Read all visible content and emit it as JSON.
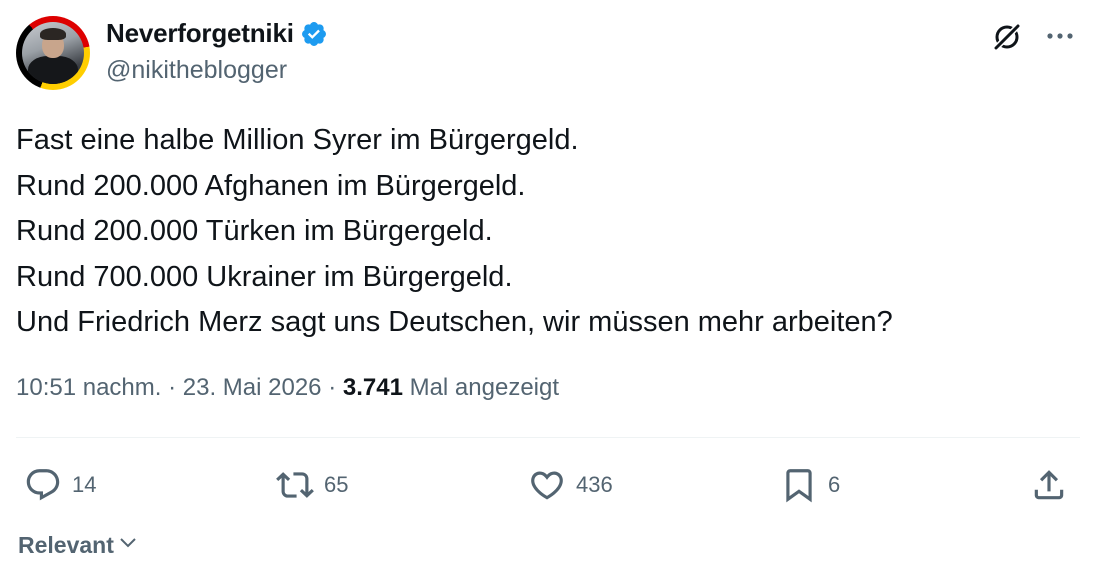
{
  "author": {
    "display_name": "Neverforgetniki",
    "handle": "@nikitheblogger",
    "verified": true,
    "verified_color": "#1d9bf0",
    "avatar_ring_colors": [
      "#000000",
      "#dd0000",
      "#ffce00"
    ]
  },
  "header_icons": {
    "grok": "grok-icon",
    "more": "more-icon"
  },
  "tweet": {
    "lines": [
      "Fast eine halbe Million Syrer im Bürgergeld.",
      "Rund 200.000 Afghanen im Bürgergeld.",
      "Rund 200.000 Türken im Bürgergeld.",
      "Rund 700.000 Ukrainer im Bürgergeld.",
      "Und Friedrich Merz sagt uns Deutschen, wir müssen mehr arbeiten?"
    ]
  },
  "meta": {
    "time": "10:51 nachm.",
    "separator": " · ",
    "date": "23. Mai 2026",
    "views_count": "3.741",
    "views_label": " Mal angezeigt"
  },
  "actions": {
    "replies": "14",
    "retweets": "65",
    "likes": "436",
    "bookmarks": "6"
  },
  "sort": {
    "label": "Relevant"
  },
  "colors": {
    "text_primary": "#0f1419",
    "text_secondary": "#536471",
    "divider": "#eff3f4"
  }
}
